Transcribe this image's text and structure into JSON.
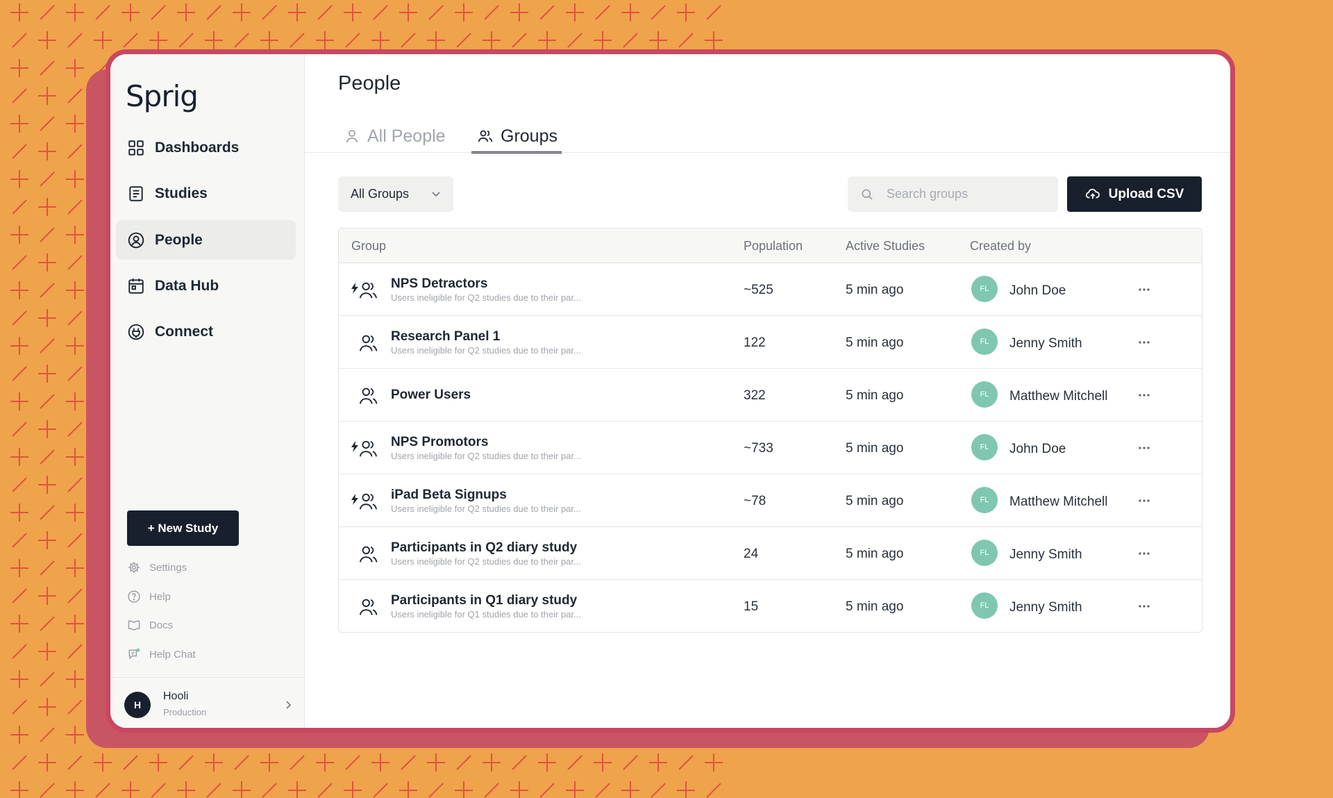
{
  "colors": {
    "background": "#EFA34B",
    "frame": "#C94761",
    "shadow": "#C95562",
    "primary": "#17202C",
    "avatar": "#7FC7B0"
  },
  "sidebar": {
    "logo": "Sprig",
    "nav": [
      {
        "label": "Dashboards",
        "icon": "dashboard-icon",
        "active": false
      },
      {
        "label": "Studies",
        "icon": "studies-icon",
        "active": false
      },
      {
        "label": "People",
        "icon": "people-icon",
        "active": true
      },
      {
        "label": "Data Hub",
        "icon": "data-hub-icon",
        "active": false
      },
      {
        "label": "Connect",
        "icon": "connect-icon",
        "active": false
      }
    ],
    "new_study_label": "+ New Study",
    "utility": [
      {
        "label": "Settings",
        "icon": "gear-icon"
      },
      {
        "label": "Help",
        "icon": "help-icon"
      },
      {
        "label": "Docs",
        "icon": "docs-icon"
      },
      {
        "label": "Help Chat",
        "icon": "chat-icon"
      }
    ],
    "account": {
      "initial": "H",
      "name": "Hooli",
      "env": "Production"
    }
  },
  "main": {
    "title": "People",
    "tabs": [
      {
        "label": "All People",
        "active": false
      },
      {
        "label": "Groups",
        "active": true
      }
    ],
    "filter": {
      "selected": "All Groups"
    },
    "search": {
      "placeholder": "Search groups"
    },
    "upload_label": "Upload CSV",
    "table": {
      "columns": [
        "Group",
        "Population",
        "Active Studies",
        "Created by"
      ],
      "rows": [
        {
          "name": "NPS Detractors",
          "desc": "Users ineligible for Q2 studies due to their par...",
          "population": "~525",
          "active": "5 min ago",
          "initials": "FL",
          "creator": "John Doe",
          "dynamic": true
        },
        {
          "name": "Research Panel 1",
          "desc": "Users ineligible for Q2 studies due to their par...",
          "population": "122",
          "active": "5 min ago",
          "initials": "FL",
          "creator": "Jenny Smith",
          "dynamic": false
        },
        {
          "name": "Power Users",
          "desc": "",
          "population": "322",
          "active": "5 min ago",
          "initials": "FL",
          "creator": "Matthew Mitchell",
          "dynamic": false
        },
        {
          "name": "NPS Promotors",
          "desc": "Users ineligible for Q2 studies due to their par...",
          "population": "~733",
          "active": "5 min ago",
          "initials": "FL",
          "creator": "John Doe",
          "dynamic": true
        },
        {
          "name": "iPad Beta Signups",
          "desc": "Users ineligible for Q2 studies due to their par...",
          "population": "~78",
          "active": "5 min ago",
          "initials": "FL",
          "creator": "Matthew Mitchell",
          "dynamic": true
        },
        {
          "name": "Participants in Q2 diary study",
          "desc": "Users ineligible for Q2 studies due to their par...",
          "population": "24",
          "active": "5 min ago",
          "initials": "FL",
          "creator": "Jenny Smith",
          "dynamic": false
        },
        {
          "name": "Participants in Q1 diary study",
          "desc": "Users ineligible for Q1 studies due to their par...",
          "population": "15",
          "active": "5 min ago",
          "initials": "FL",
          "creator": "Jenny Smith",
          "dynamic": false
        }
      ]
    }
  }
}
